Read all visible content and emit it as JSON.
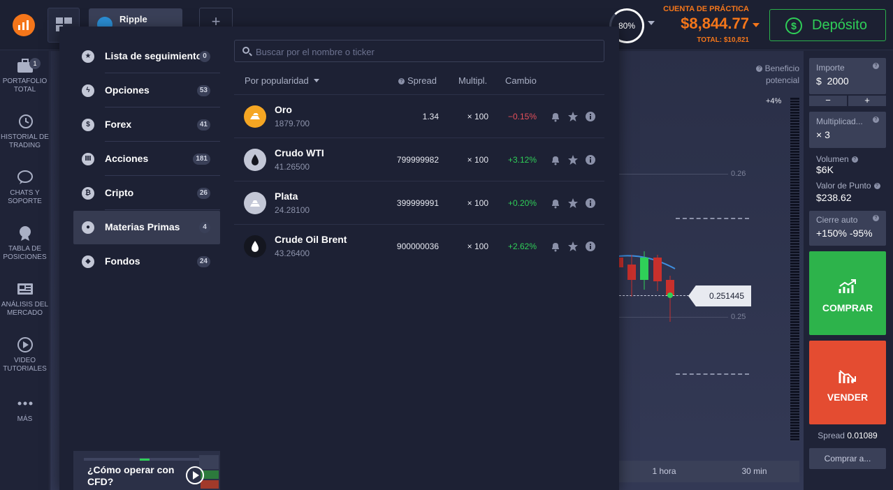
{
  "header": {
    "asset_tab_label": "Ripple",
    "add_tab_symbol": "+",
    "gauge_label": "80%",
    "account_label": "CUENTA DE PRÁCTICA",
    "balance": "$8,844.77",
    "total": "TOTAL: $10,821",
    "deposit_label": "Depósito"
  },
  "leftnav": {
    "portfolio_badge": "1",
    "items": [
      {
        "label": "PORTAFOLIO TOTAL",
        "icon": "briefcase-icon"
      },
      {
        "label": "HISTORIAL DE TRADING",
        "icon": "history-icon"
      },
      {
        "label": "CHATS Y SOPORTE",
        "icon": "chat-icon"
      },
      {
        "label": "TABLA DE POSICIONES",
        "icon": "trophy-icon"
      },
      {
        "label": "ANÁLISIS DEL MERCADO",
        "icon": "news-icon"
      },
      {
        "label": "VIDEO TUTORIALES",
        "icon": "play-icon"
      },
      {
        "label": "MÁS",
        "icon": "more-icon"
      }
    ]
  },
  "popup": {
    "categories": [
      {
        "label": "Lista de seguimiento",
        "count": "0",
        "icon": "star-icon"
      },
      {
        "label": "Opciones",
        "count": "53",
        "icon": "lightning-icon"
      },
      {
        "label": "Forex",
        "count": "41",
        "icon": "dollar-icon"
      },
      {
        "label": "Acciones",
        "count": "181",
        "icon": "bank-icon"
      },
      {
        "label": "Cripto",
        "count": "26",
        "icon": "bitcoin-icon"
      },
      {
        "label": "Materias Primas",
        "count": "4",
        "icon": "drop-icon"
      },
      {
        "label": "Fondos",
        "count": "24",
        "icon": "cube-icon"
      }
    ],
    "search_placeholder": "Buscar por el nombre o ticker",
    "columns": {
      "sort": "Por popularidad",
      "spread": "Spread",
      "multiplier": "Multipl.",
      "change": "Cambio"
    },
    "assets": [
      {
        "name": "Oro",
        "price": "1879.700",
        "spread": "1.34",
        "multiplier": "× 100",
        "change": "−0.15%",
        "change_color": "#e8505b",
        "icon_color": "#f5a623"
      },
      {
        "name": "Crudo WTI",
        "price": "41.26500",
        "spread": "799999982",
        "multiplier": "× 100",
        "change": "+3.12%",
        "change_color": "#2fcf58",
        "icon_color": "#c3c7d6"
      },
      {
        "name": "Plata",
        "price": "24.28100",
        "spread": "399999991",
        "multiplier": "× 100",
        "change": "+0.20%",
        "change_color": "#2fcf58",
        "icon_color": "#c3c7d6"
      },
      {
        "name": "Crude Oil Brent",
        "price": "43.26400",
        "spread": "900000036",
        "multiplier": "× 100",
        "change": "+2.62%",
        "change_color": "#2fcf58",
        "icon_color": "#14161f"
      }
    ],
    "video_title": "¿Cómo operar con CFD?"
  },
  "chart": {
    "price_level_1": "0.26",
    "price_level_2": "0.25",
    "current_price": "0.251445",
    "benefit_label": "Beneficio potencial",
    "scale_top": "+4%",
    "timeframes": [
      "1 hora",
      "30 min"
    ]
  },
  "rightpanel": {
    "amount_label": "Importe",
    "amount_currency": "$",
    "amount_value": "2000",
    "minus": "−",
    "plus": "+",
    "multiplier_label": "Multiplicad...",
    "multiplier_value": "× 3",
    "volume_label": "Volumen",
    "volume_value": "$6K",
    "point_value_label": "Valor de Punto",
    "point_value": "$238.62",
    "autoclose_label": "Cierre auto",
    "autoclose_value": "+150% -95%",
    "buy_label": "COMPRAR",
    "sell_label": "VENDER",
    "spread_label": "Spread",
    "spread_value": "0.01089",
    "buy_at_label": "Comprar a..."
  }
}
